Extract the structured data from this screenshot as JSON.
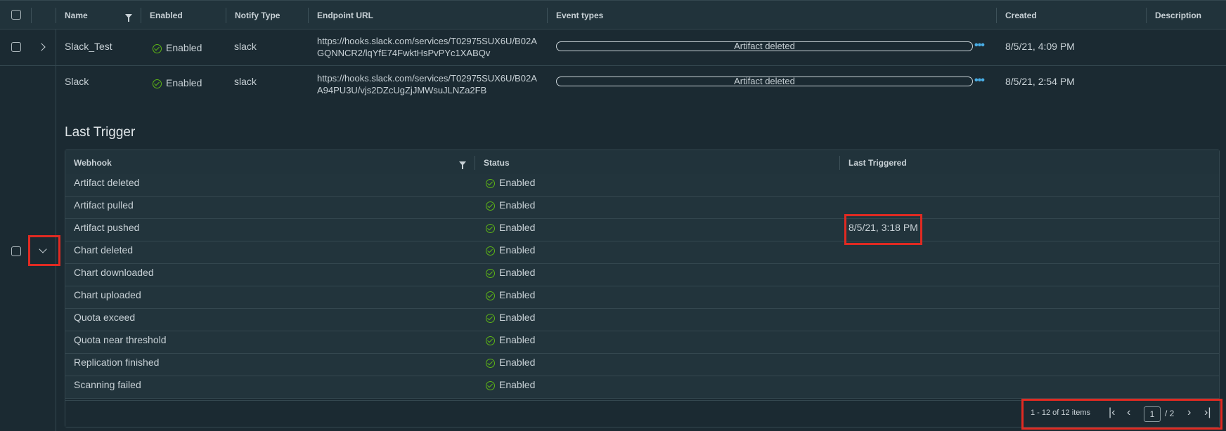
{
  "grid": {
    "columns": [
      "Name",
      "Enabled",
      "Notify Type",
      "Endpoint URL",
      "Event types",
      "Created",
      "Description"
    ],
    "rows": [
      {
        "name": "Slack_Test",
        "enabled": "Enabled",
        "notify_type": "slack",
        "endpoint_url": "https://hooks.slack.com/services/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",
        "event_type": "Artifact deleted",
        "created": "8/5/21, 4:09 PM"
      },
      {
        "name": "Slack",
        "enabled": "Enabled",
        "notify_type": "slack",
        "endpoint_url": "https://hooks.slack.com/services/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",
        "event_type": "Artifact deleted",
        "created": "8/5/21, 2:54 PM"
      }
    ],
    "more_icon": "ellipsis-icon"
  },
  "detail": {
    "title": "Last Trigger",
    "columns": [
      "Webhook",
      "Status",
      "Last Triggered"
    ],
    "rows": [
      {
        "webhook": "Artifact deleted",
        "status": "Enabled",
        "last": ""
      },
      {
        "webhook": "Artifact pulled",
        "status": "Enabled",
        "last": ""
      },
      {
        "webhook": "Artifact pushed",
        "status": "Enabled",
        "last": "8/5/21, 3:18 PM"
      },
      {
        "webhook": "Chart deleted",
        "status": "Enabled",
        "last": ""
      },
      {
        "webhook": "Chart downloaded",
        "status": "Enabled",
        "last": ""
      },
      {
        "webhook": "Chart uploaded",
        "status": "Enabled",
        "last": ""
      },
      {
        "webhook": "Quota exceed",
        "status": "Enabled",
        "last": ""
      },
      {
        "webhook": "Quota near threshold",
        "status": "Enabled",
        "last": ""
      },
      {
        "webhook": "Replication finished",
        "status": "Enabled",
        "last": ""
      },
      {
        "webhook": "Scanning failed",
        "status": "Enabled",
        "last": ""
      }
    ],
    "pagination": {
      "summary": "1 - 12 of 12 items",
      "page": "1",
      "total": "/ 2"
    }
  },
  "colors": {
    "background": "#1b2a32",
    "header": "#21333b",
    "success": "#5eb715",
    "link": "#49aee6",
    "highlight": "#e02a22"
  }
}
